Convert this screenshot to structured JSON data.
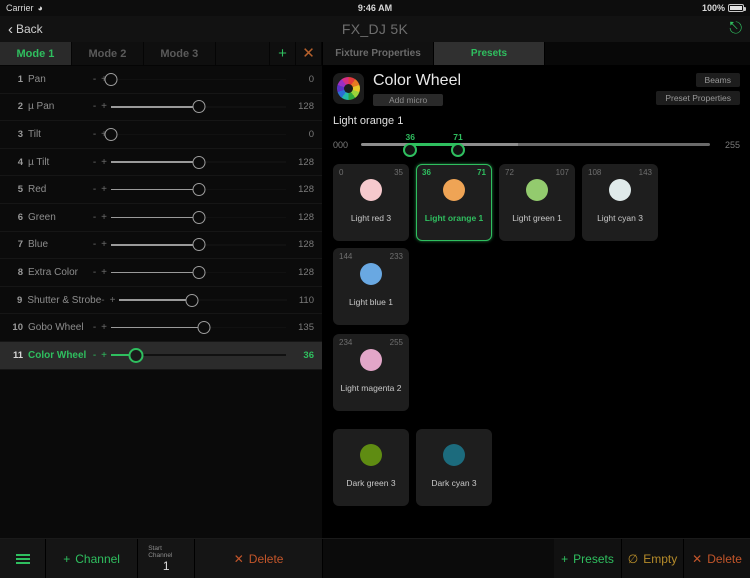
{
  "status_bar": {
    "carrier": "Carrier",
    "wifi_icon": "wifi-icon",
    "time": "9:46 AM",
    "battery_percent": "100%"
  },
  "nav_bar": {
    "back_label": "Back",
    "title": "FX_DJ 5K",
    "action_icon": "lightning-bolt-icon"
  },
  "mode_tabs": {
    "tabs": [
      {
        "label": "Mode 1",
        "active": true
      },
      {
        "label": "Mode 2",
        "active": false
      },
      {
        "label": "Mode 3",
        "active": false
      }
    ],
    "add_icon": "plus-icon",
    "close_icon": "close-icon"
  },
  "channels": {
    "minus_label": "-",
    "plus_label": "+",
    "rows": [
      {
        "num": "1",
        "name": "Pan",
        "value": "0",
        "pct": 0
      },
      {
        "num": "2",
        "name": "µ Pan",
        "value": "128",
        "pct": 50
      },
      {
        "num": "3",
        "name": "Tilt",
        "value": "0",
        "pct": 0
      },
      {
        "num": "4",
        "name": "µ Tilt",
        "value": "128",
        "pct": 50
      },
      {
        "num": "5",
        "name": "Red",
        "value": "128",
        "pct": 50
      },
      {
        "num": "6",
        "name": "Green",
        "value": "128",
        "pct": 50
      },
      {
        "num": "7",
        "name": "Blue",
        "value": "128",
        "pct": 50
      },
      {
        "num": "8",
        "name": "Extra Color",
        "value": "128",
        "pct": 50
      },
      {
        "num": "9",
        "name": "Shutter & Strobe",
        "value": "110",
        "pct": 43
      },
      {
        "num": "10",
        "name": "Gobo Wheel",
        "value": "135",
        "pct": 53
      },
      {
        "num": "11",
        "name": "Color Wheel",
        "value": "36",
        "pct": 14,
        "selected": true
      }
    ]
  },
  "panel_tabs": [
    {
      "label": "Fixture Properties",
      "active": false
    },
    {
      "label": "Presets",
      "active": true
    }
  ],
  "preset_header": {
    "icon": "color-wheel-icon",
    "title": "Color Wheel",
    "add_micro_label": "Add micro",
    "beams_label": "Beams",
    "preset_properties_label": "Preset Properties",
    "selected_preset_name": "Light orange 1"
  },
  "range_slider": {
    "min_label": "000",
    "max_label": "255",
    "low_value": "36",
    "high_value": "71",
    "low_pct": 14.1,
    "high_pct": 27.8,
    "accent": "#2fbf5f"
  },
  "preset_groups": [
    {
      "cards": [
        {
          "low": "0",
          "high": "35",
          "name": "Light red 3",
          "color": "#f6c9cd",
          "selected": false
        },
        {
          "low": "36",
          "high": "71",
          "name": "Light orange 1",
          "color": "#efa455",
          "selected": true
        },
        {
          "low": "72",
          "high": "107",
          "name": "Light green 1",
          "color": "#93cb6e",
          "selected": false
        },
        {
          "low": "108",
          "high": "143",
          "name": "Light cyan 3",
          "color": "#dfeaea",
          "selected": false
        },
        {
          "low": "144",
          "high": "233",
          "name": "Light blue 1",
          "color": "#69a8e2",
          "selected": false
        }
      ]
    },
    {
      "cards": [
        {
          "low": "234",
          "high": "255",
          "name": "Light magenta 2",
          "color": "#e2a6c8",
          "selected": false
        }
      ]
    },
    {
      "dim": true,
      "cards": [
        {
          "low": "",
          "high": "",
          "name": "Dark green 3",
          "color": "#5f8c12",
          "selected": false
        },
        {
          "low": "",
          "high": "",
          "name": "Dark cyan 3",
          "color": "#1c6b7d",
          "selected": false
        }
      ]
    }
  ],
  "bottom_bar": {
    "menu_icon": "hamburger-menu-icon",
    "add_channel_label": "Channel",
    "add_channel_icon": "plus-icon",
    "start_channel_label": "Start Channel",
    "start_channel_value": "1",
    "delete_left_label": "Delete",
    "delete_left_icon": "close-icon",
    "presets_label": "Presets",
    "presets_icon": "plus-icon",
    "empty_label": "Empty",
    "empty_icon": "slash-circle-icon",
    "delete_right_label": "Delete",
    "delete_right_icon": "close-icon"
  }
}
